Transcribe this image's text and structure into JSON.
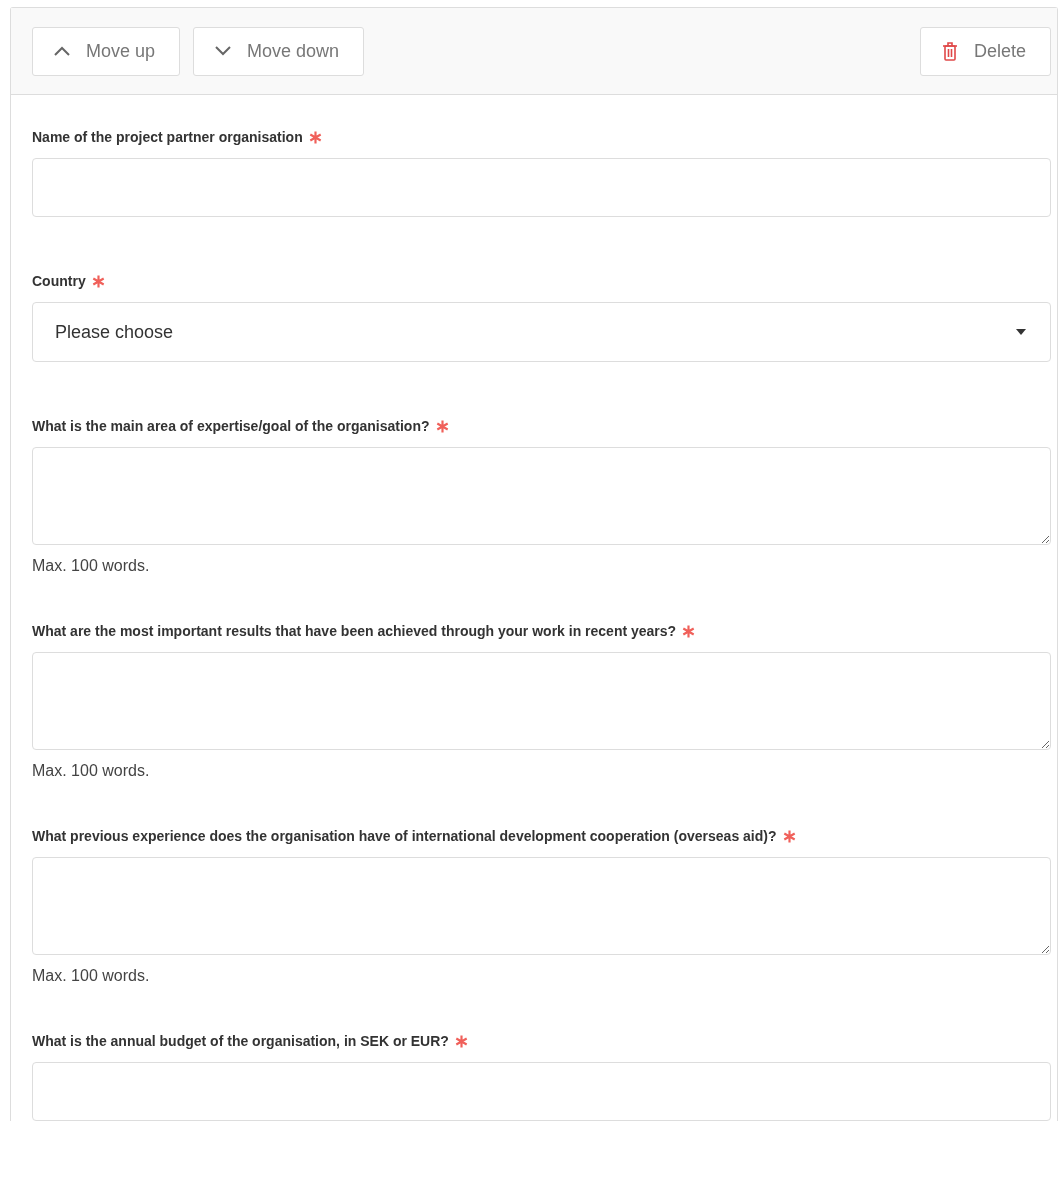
{
  "toolbar": [
    {
      "kind": "up",
      "label": "Move up"
    },
    {
      "kind": "down",
      "label": "Move down"
    },
    {
      "kind": "delete",
      "label": "Delete"
    }
  ],
  "fields": [
    {
      "kind": "text",
      "label": "Name of the project partner organisation",
      "required": true
    },
    {
      "kind": "select",
      "label": "Country",
      "required": true,
      "value": "Please choose"
    },
    {
      "kind": "textarea",
      "label": "What is the main area of expertise/goal of the organisation?",
      "required": true,
      "hint": "Max. 100 words."
    },
    {
      "kind": "textarea",
      "label": "What are the most important results that have been achieved through your work in recent years?",
      "required": true,
      "hint": "Max. 100 words."
    },
    {
      "kind": "textarea",
      "label": "What previous experience does the organisation have of international development cooperation (overseas aid)?",
      "required": true,
      "hint": "Max. 100 words."
    },
    {
      "kind": "text",
      "label": "What is the annual budget of the organisation, in SEK or EUR?",
      "required": true
    }
  ]
}
